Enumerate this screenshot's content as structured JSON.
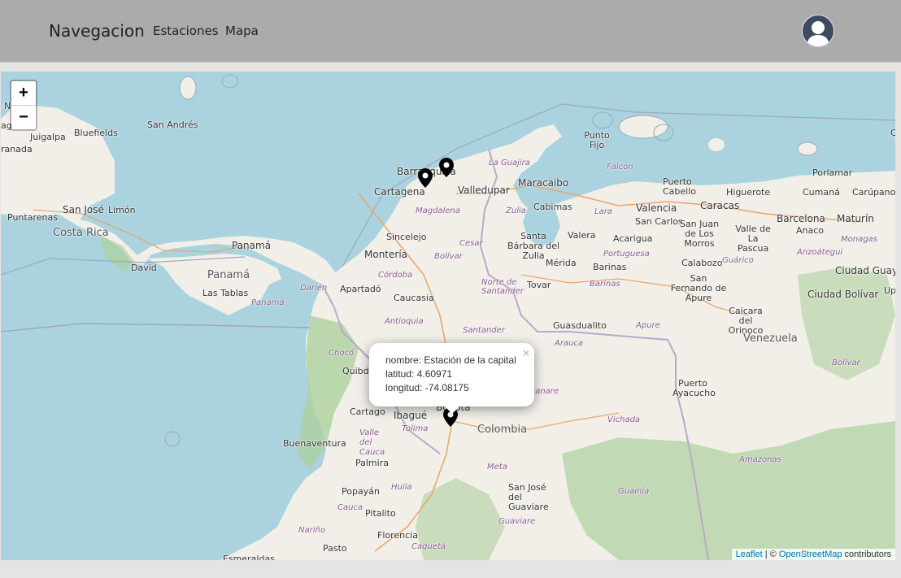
{
  "navbar": {
    "brand": "Navegacion",
    "links": [
      "Estaciones",
      "Mapa"
    ]
  },
  "map": {
    "zoom_in": "+",
    "zoom_out": "−",
    "labels": {
      "nicaragua_frag": "Ni    ua",
      "managua_frag": "ag",
      "granada_frag": "ranada",
      "juigalpa": "Juigalpa",
      "bluefields": "Bluefields",
      "san_andres": "San Andrés",
      "puntarenas": "Puntarenas",
      "san_jose_cr": "San José",
      "limon": "Limón",
      "costa_rica": "Costa Rica",
      "david": "David",
      "panama_city": "Panamá",
      "panama_country": "Panamá",
      "panama_region": "Panamá",
      "las_tablas": "Las Tablas",
      "darien": "Darién",
      "barranquilla": "Barranquilla",
      "cartagena": "Cartagena",
      "valledupar": "Valledupar",
      "la_guajira": "La Guajira",
      "magdalena": "Magdalena",
      "sincelejo": "Sincelejo",
      "cesar": "Cesar",
      "monteria": "Montería",
      "bolivar_co": "Bolívar",
      "cordoba": "Córdoba",
      "apartado": "Apartadó",
      "caucasia": "Caucasia",
      "antioquia": "Antioquia",
      "norte_santander": "Norte de Santander",
      "santander": "Santander",
      "choco": "Chocó",
      "quibdo": "Quibdó",
      "cartago": "Cartago",
      "ibague": "Ibagué",
      "bogota_frag": "Bogota",
      "colombia": "Colombia",
      "tolima": "Tolima",
      "valle_del_cauca": "Valle del Cauca",
      "buenaventura": "Buenaventura",
      "palmira": "Palmira",
      "popayan": "Popayán",
      "huila": "Huila",
      "cauca": "Cauca",
      "pitalito": "Pitalito",
      "narino": "Nariño",
      "florencia": "Florencia",
      "pasto": "Pasto",
      "caqueta": "Caquetá",
      "esmeraldas": "Esmeraldas",
      "meta": "Meta",
      "sj_guaviare": "San José del Guaviare",
      "guaviare": "Guaviare",
      "guainia": "Guainía",
      "vichada": "Vichada",
      "casanare_frag": "sanare",
      "arauca": "Arauca",
      "guasdualito": "Guasdualito",
      "apure": "Apure",
      "tovar": "Tovar",
      "merida": "Mérida",
      "barinas_city": "Barinas",
      "barinas_state": "Barinas",
      "maracaibo": "Maracaibo",
      "cabimas": "Cabimas",
      "zulia": "Zulia",
      "santa_barbara": "Santa Bárbara del Zulia",
      "valera": "Valera",
      "lara": "Lara",
      "portuguesa": "Portuguesa",
      "punto_fijo": "Punto Fijo",
      "falcon": "Falcón",
      "puerto_cabello": "Puerto Cabello",
      "valencia": "Valencia",
      "caracas": "Caracas",
      "higuerote": "Higuerote",
      "san_carlos": "San Carlos",
      "acarigua": "Acarigua",
      "san_juan_morros": "San Juan de Los Morros",
      "calabozo": "Calabozo",
      "guarico": "Guárico",
      "san_fernando": "San Fernando de Apure",
      "caicara": "Caicara del Orinoco",
      "venezuela": "Venezuela",
      "barcelona": "Barcelona",
      "valle_pascua": "Valle de La Pascua",
      "anaco": "Anaco",
      "anzoategui": "Anzoátegui",
      "porlamar": "Porlamar",
      "cumana": "Cumaná",
      "carupano": "Carúpano",
      "maturin": "Maturín",
      "monagas": "Monagas",
      "ciudad_guayana": "Ciudad Guay",
      "ciudad_bolivar": "Ciudad Bolívar",
      "up_frag": "Up",
      "bolivar_ve": "Bolívar",
      "puerto_ayacucho": "Puerto Ayacucho",
      "amazonas": "Amazonas",
      "c_frag": "C"
    }
  },
  "popup": {
    "line1": "nombre: Estación de la capital",
    "line2": "latitud: 4.60971",
    "line3": "longitud: -74.08175",
    "close": "×"
  },
  "attribution": {
    "leaflet": "Leaflet",
    "sep": " | © ",
    "osm": "OpenStreetMap",
    "contributors": " contributors"
  }
}
